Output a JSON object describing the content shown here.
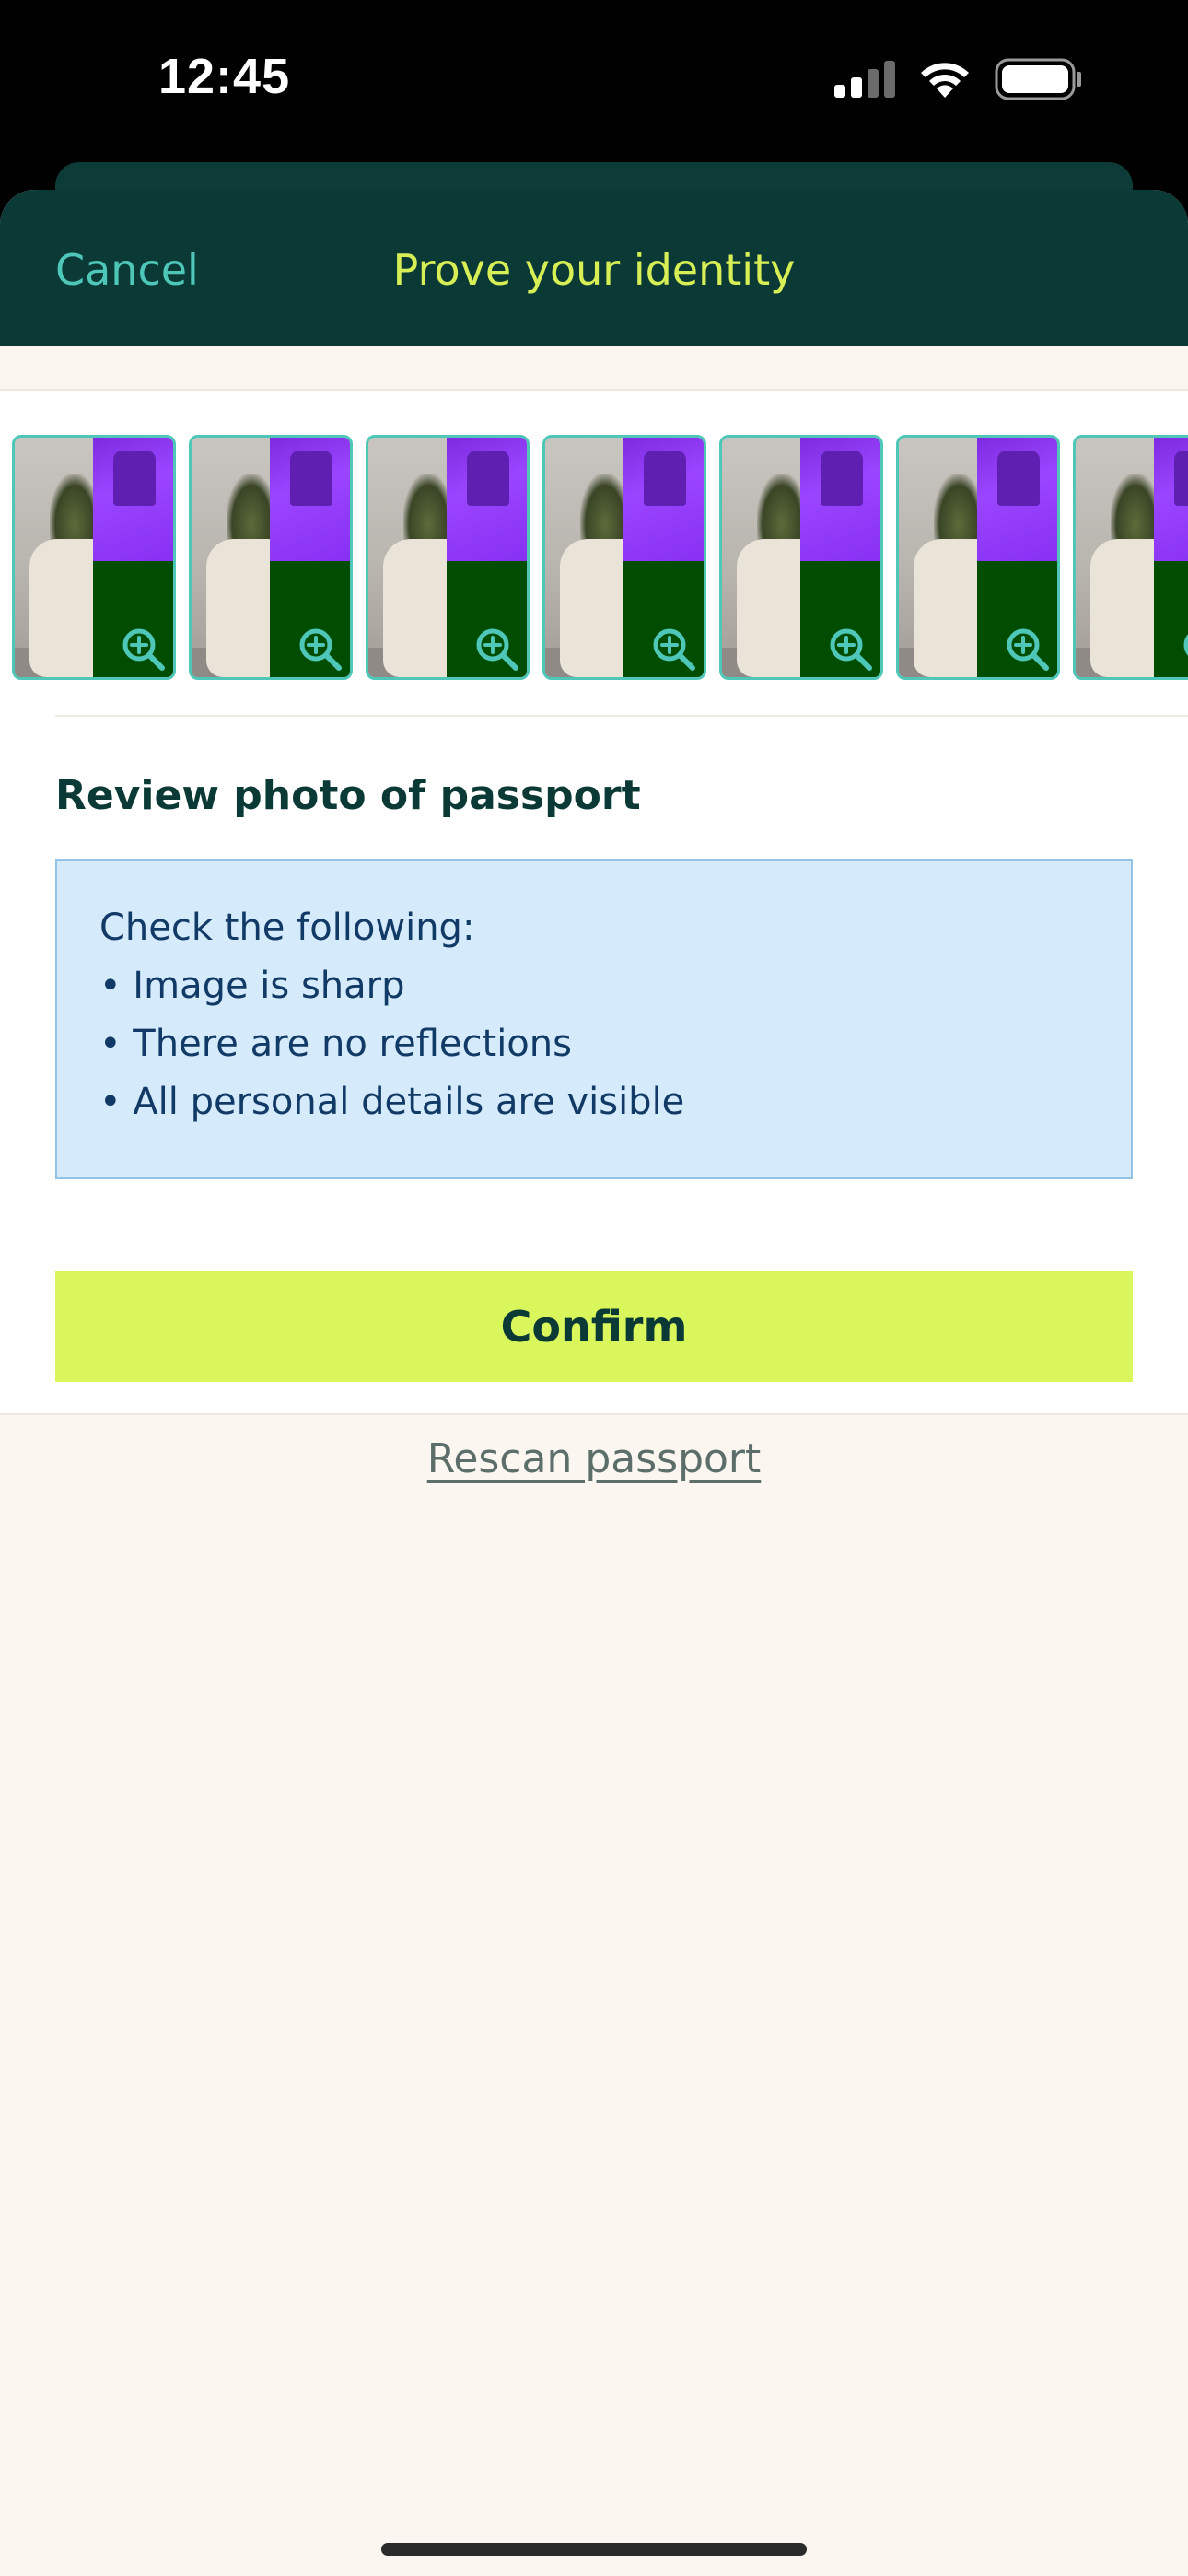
{
  "status_bar": {
    "time": "12:45",
    "icons": [
      "cellular-signal-icon",
      "wifi-icon",
      "battery-icon"
    ]
  },
  "header": {
    "cancel_label": "Cancel",
    "title": "Prove your identity"
  },
  "thumbnails": {
    "count": 7,
    "icon": "zoom-in-icon"
  },
  "review": {
    "title": "Review photo of passport",
    "checklist_intro": "Check the following:",
    "checklist": [
      "• Image is sharp",
      "• There are no reflections",
      "• All personal details are visible"
    ]
  },
  "actions": {
    "confirm_label": "Confirm",
    "rescan_label": "Rescan passport"
  },
  "colors": {
    "header_bg": "#0b3a36",
    "accent_teal": "#4ec7b8",
    "accent_lime": "#d9f75c",
    "title_lime": "#d7ef55",
    "info_bg": "#d5ebfb",
    "page_bg": "#fbf6f0"
  }
}
